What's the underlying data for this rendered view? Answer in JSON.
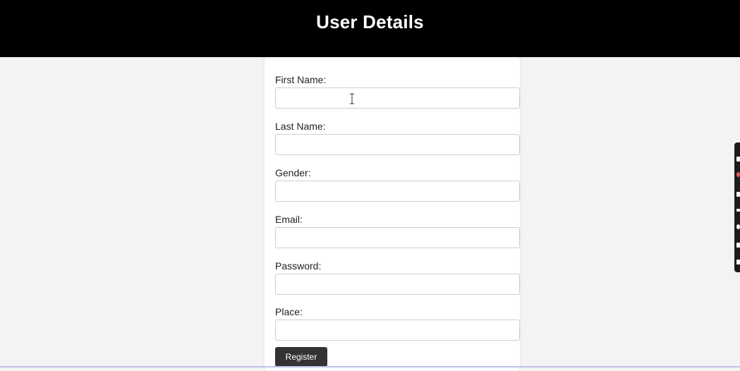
{
  "header": {
    "title": "User Details"
  },
  "form": {
    "fields": [
      {
        "label": "First Name:",
        "value": "",
        "placeholder": ""
      },
      {
        "label": "Last Name:",
        "value": "",
        "placeholder": ""
      },
      {
        "label": "Gender:",
        "value": "",
        "placeholder": ""
      },
      {
        "label": "Email:",
        "value": "",
        "placeholder": ""
      },
      {
        "label": "Password:",
        "value": "",
        "placeholder": ""
      },
      {
        "label": "Place:",
        "value": "",
        "placeholder": ""
      }
    ],
    "submit_label": "Register"
  },
  "colors": {
    "header_bg": "#000000",
    "header_text": "#ffffff",
    "page_bg": "#f3f3f3",
    "button_bg": "#333333"
  },
  "icons": {
    "cursor": "text-cursor-icon"
  }
}
